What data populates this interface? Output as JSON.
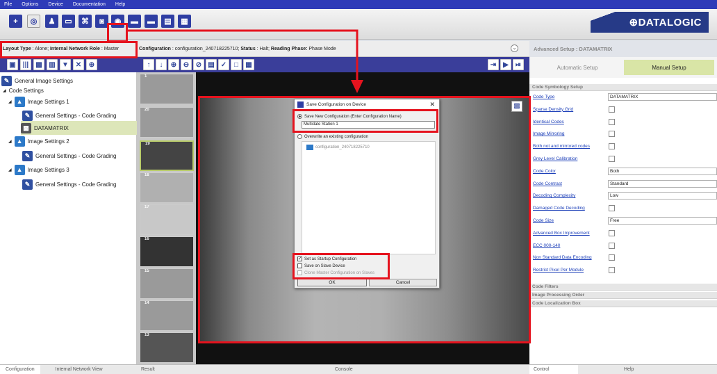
{
  "menu": [
    "File",
    "Options",
    "Device",
    "Documentation",
    "Help"
  ],
  "brand": "⊕DATALOGIC",
  "infobar": {
    "layout_label": "Layout Type",
    "layout_value": "Alone",
    "role_label": "Internal Network Role",
    "role_value": "Master",
    "config_label": "Configuration",
    "config_value": "configuration_240718225710;",
    "status_label": "Status",
    "status_value": "Halt",
    "phase_label": "Reading Phase:",
    "phase_value": "Phase Mode"
  },
  "tree": [
    {
      "label": "General Image Settings",
      "icon": "gear-icon"
    },
    {
      "label": "Code Settings",
      "icon": ""
    },
    {
      "label": "Image Settings 1",
      "icon": "image-icon"
    },
    {
      "label": "General Settings - Code Grading",
      "icon": "gear-icon"
    },
    {
      "label": "DATAMATRIX",
      "icon": "datamatrix-icon"
    },
    {
      "label": "Image Settings 2",
      "icon": "image-icon"
    },
    {
      "label": "General Settings - Code Grading",
      "icon": "gear-icon"
    },
    {
      "label": "Image Settings 3",
      "icon": "image-icon"
    },
    {
      "label": "General Settings - Code Grading",
      "icon": "gear-icon"
    }
  ],
  "left_tabs": [
    "Configuration",
    "Internal Network View"
  ],
  "center_tabs": [
    "Result",
    "Console"
  ],
  "thumbs": [
    "1",
    "20",
    "19",
    "18",
    "17",
    "16",
    "15",
    "14",
    "13"
  ],
  "dialog": {
    "title": "Save Configuration on Device",
    "opt_new": "Save New Configuration (Enter Configuration Name)",
    "name_value": "Multidate Station 1",
    "opt_overwrite": "Overwrite an existing configuration",
    "existing_item": "configuration_240718225710",
    "chk_startup": "Set as Startup Configuration",
    "chk_slave": "Save on Slave Device",
    "chk_clone": "Clone Master Configuration on Slaves",
    "ok": "OK",
    "cancel": "Cancel"
  },
  "right": {
    "title": "Advanced Setup : DATAMATRIX",
    "tab_auto": "Automatic Setup",
    "tab_manual": "Manual Setup",
    "sec_symbology": "Code Symbology Setup",
    "params": [
      {
        "label": "Code Type",
        "value": "DATAMATRIX",
        "kind": "text"
      },
      {
        "label": "Sparse Density Grid",
        "value": "",
        "kind": "check"
      },
      {
        "label": "Identical Codes",
        "value": "",
        "kind": "check"
      },
      {
        "label": "Image Mirroring",
        "value": "",
        "kind": "check"
      },
      {
        "label": "Both not and mirrored codes",
        "value": "",
        "kind": "check"
      },
      {
        "label": "Grey Level Calibration",
        "value": "",
        "kind": "check"
      },
      {
        "label": "Code Color",
        "value": "Both",
        "kind": "text"
      },
      {
        "label": "Code Contrast",
        "value": "Standard",
        "kind": "text"
      },
      {
        "label": "Decoding Complexity",
        "value": "Low",
        "kind": "text"
      },
      {
        "label": "Damaged Code Decoding",
        "value": "",
        "kind": "check"
      },
      {
        "label": "Code Size",
        "value": "Free",
        "kind": "text"
      },
      {
        "label": "Advanced Box Improvement",
        "value": "",
        "kind": "check"
      },
      {
        "label": "ECC 000-140",
        "value": "",
        "kind": "check"
      },
      {
        "label": "Non Standard Data Encoding",
        "value": "",
        "kind": "check"
      },
      {
        "label": "Restrict Pixel Per Module",
        "value": "",
        "kind": "check"
      }
    ],
    "sec_filters": "Code Filters",
    "sec_order": "Image Processing Order",
    "sec_loc": "Code Localization Box",
    "bottom_tabs": [
      "Control",
      "Help"
    ]
  },
  "colors": {
    "highlight": "#e5131e",
    "menubar": "#2e3bb8",
    "toolbar_dark": "#3a3e9a",
    "manual_tab": "#d9e5a6",
    "tree_selected": "#dde6b9"
  }
}
